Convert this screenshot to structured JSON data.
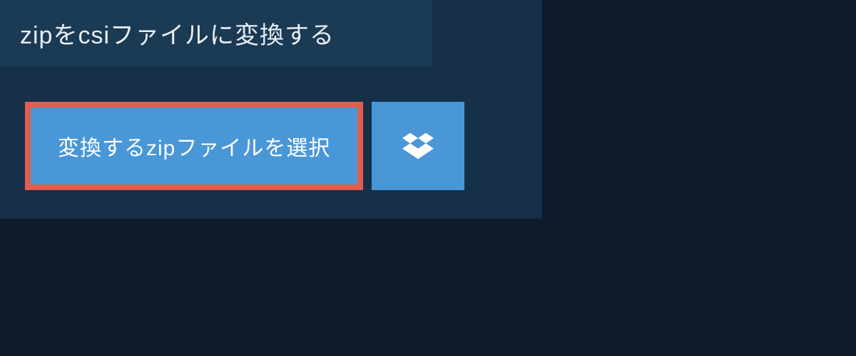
{
  "header": {
    "title": "zipをcsiファイルに変換する"
  },
  "actions": {
    "select_file_label": "変換するzipファイルを選択"
  }
}
